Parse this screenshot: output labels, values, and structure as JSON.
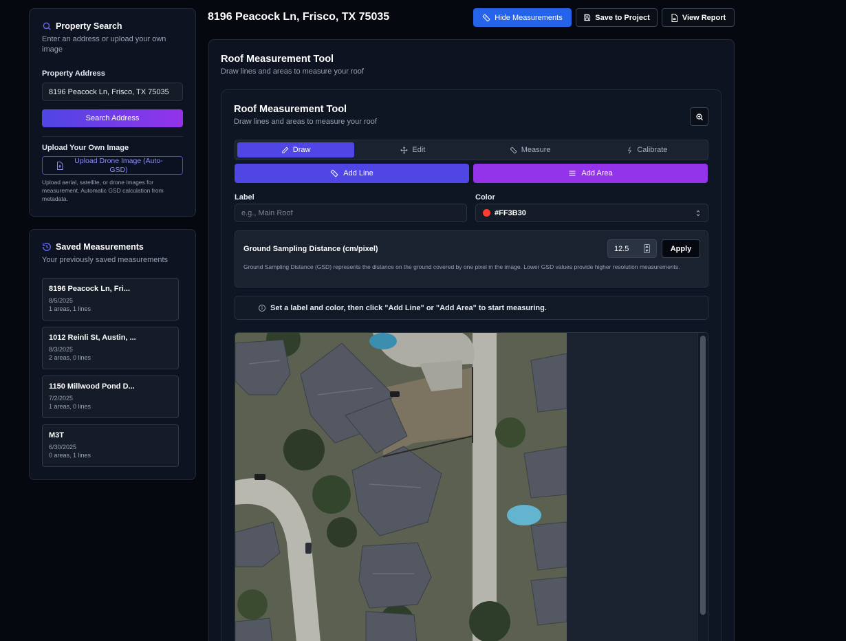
{
  "sidebar": {
    "search": {
      "title": "Property Search",
      "subtitle": "Enter an address or upload your own image",
      "address_label": "Property Address",
      "address_value": "8196 Peacock Ln, Frisco, TX 75035",
      "search_button": "Search Address",
      "upload_label": "Upload Your Own Image",
      "upload_button": "Upload Drone Image (Auto-GSD)",
      "upload_note": "Upload aerial, satellite, or drone images for measurement. Automatic GSD calculation from metadata."
    },
    "saved": {
      "title": "Saved Measurements",
      "subtitle": "Your previously saved measurements",
      "items": [
        {
          "name": "8196 Peacock Ln, Fri...",
          "date": "8/5/2025",
          "summary": "1 areas, 1 lines"
        },
        {
          "name": "1012 Reinli St, Austin, ...",
          "date": "8/3/2025",
          "summary": "2 areas, 0 lines"
        },
        {
          "name": "1150 Millwood Pond D...",
          "date": "7/2/2025",
          "summary": "1 areas, 0 lines"
        },
        {
          "name": "M3T",
          "date": "6/30/2025",
          "summary": "0 areas, 1 lines"
        }
      ]
    }
  },
  "header": {
    "title": "8196 Peacock Ln, Frisco, TX 75035",
    "hide_measurements": "Hide Measurements",
    "save_to_project": "Save to Project",
    "view_report": "View Report"
  },
  "main": {
    "outer_title": "Roof Measurement Tool",
    "outer_subtitle": "Draw lines and areas to measure your roof",
    "inner_title": "Roof Measurement Tool",
    "inner_subtitle": "Draw lines and areas to measure your roof",
    "tabs": [
      {
        "label": "Draw",
        "icon": "pencil-icon",
        "active": true
      },
      {
        "label": "Edit",
        "icon": "move-icon",
        "active": false
      },
      {
        "label": "Measure",
        "icon": "ruler-icon",
        "active": false
      },
      {
        "label": "Calibrate",
        "icon": "lightning-icon",
        "active": false
      }
    ],
    "add_line": "Add Line",
    "add_area": "Add Area",
    "label_field": {
      "label": "Label",
      "placeholder": "e.g., Main Roof",
      "value": ""
    },
    "color_field": {
      "label": "Color",
      "value": "#FF3B30"
    },
    "gsd": {
      "title": "Ground Sampling Distance (cm/pixel)",
      "value": "12.5",
      "apply": "Apply",
      "description": "Ground Sampling Distance (GSD) represents the distance on the ground covered by one pixel in the image. Lower GSD values provide higher resolution measurements."
    },
    "info_message": "Set a label and color, then click \"Add Line\" or \"Add Area\" to start measuring."
  },
  "colors": {
    "accent_blue": "#2563eb",
    "accent_indigo": "#4f46e5",
    "accent_purple": "#9333ea",
    "measure_color": "#FF3B30"
  }
}
